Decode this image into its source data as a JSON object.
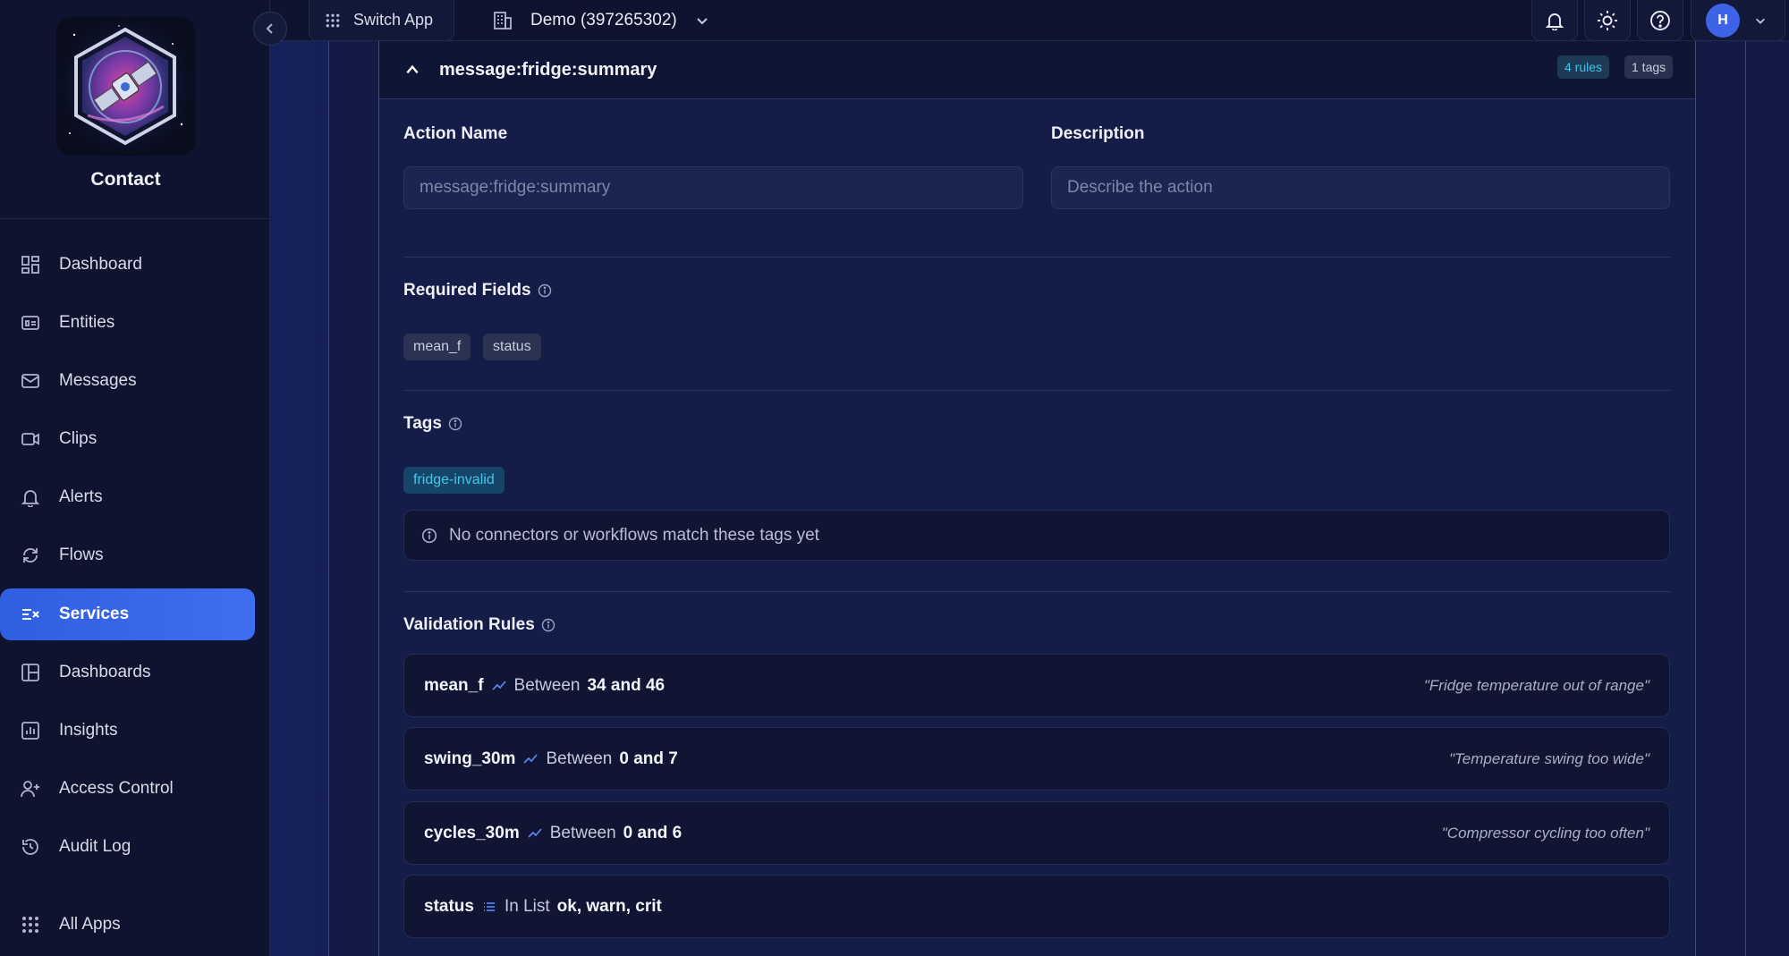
{
  "sidebar": {
    "app_name": "Contact",
    "items": [
      {
        "label": "Dashboard",
        "icon": "dashboard-icon"
      },
      {
        "label": "Entities",
        "icon": "entities-icon"
      },
      {
        "label": "Messages",
        "icon": "mail-icon"
      },
      {
        "label": "Clips",
        "icon": "video-icon"
      },
      {
        "label": "Alerts",
        "icon": "bell-icon"
      },
      {
        "label": "Flows",
        "icon": "refresh-icon"
      },
      {
        "label": "Services",
        "icon": "services-icon",
        "active": true
      },
      {
        "label": "Dashboards",
        "icon": "layout-icon"
      },
      {
        "label": "Insights",
        "icon": "chart-icon"
      },
      {
        "label": "Access Control",
        "icon": "user-plus-icon"
      },
      {
        "label": "Audit Log",
        "icon": "history-icon"
      },
      {
        "label": "All Apps",
        "icon": "grid-icon"
      }
    ]
  },
  "topbar": {
    "switch_app_label": "Switch App",
    "org_label": "Demo (397265302)",
    "avatar_initial": "H"
  },
  "action": {
    "title": "message:fridge:summary",
    "rules_badge": "4 rules",
    "tags_badge": "1 tags",
    "name_label": "Action Name",
    "name_value": "message:fridge:summary",
    "description_label": "Description",
    "description_placeholder": "Describe the action",
    "required_fields_label": "Required Fields",
    "required_fields": [
      "mean_f",
      "status"
    ],
    "tags_label": "Tags",
    "tags": [
      "fridge-invalid"
    ],
    "tags_notice": "No connectors or workflows match these tags yet",
    "validation_label": "Validation Rules",
    "rules": [
      {
        "field": "mean_f",
        "op_icon": "trend-icon",
        "op": "Between",
        "value": "34 and 46",
        "message": "\"Fridge temperature out of range\""
      },
      {
        "field": "swing_30m",
        "op_icon": "trend-icon",
        "op": "Between",
        "value": "0 and 7",
        "message": "\"Temperature swing too wide\""
      },
      {
        "field": "cycles_30m",
        "op_icon": "trend-icon",
        "op": "Between",
        "value": "0 and 6",
        "message": "\"Compressor cycling too often\""
      },
      {
        "field": "status",
        "op_icon": "list-icon",
        "op": "In List",
        "value": "ok, warn, crit",
        "message": ""
      }
    ]
  },
  "colors": {
    "accent": "#3f6ff0",
    "tag_text": "#44c7ea",
    "background": "#0f1535"
  }
}
